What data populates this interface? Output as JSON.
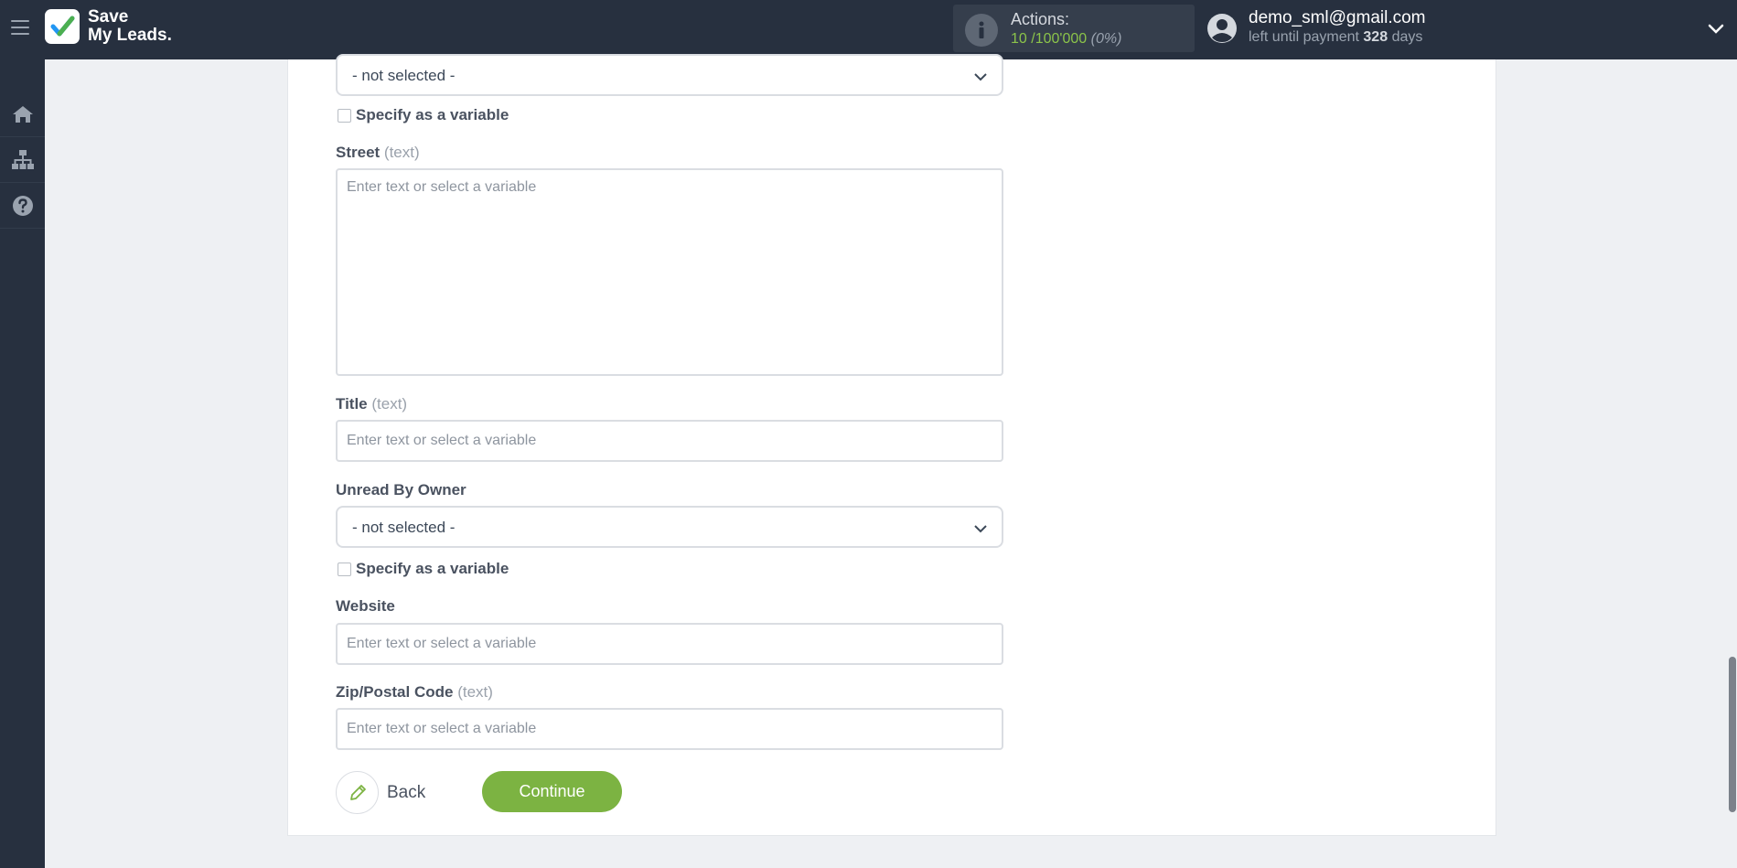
{
  "app": {
    "brand_line1": "Save",
    "brand_line2": "My Leads."
  },
  "header": {
    "actions_label": "Actions:",
    "actions_used": "10",
    "actions_total": "100'000",
    "actions_percent": "(0%)",
    "user_email": "demo_sml@gmail.com",
    "payment_prefix": "left until payment",
    "payment_days": "328",
    "payment_suffix": "days"
  },
  "sidebar": {
    "items": [
      {
        "icon": "home-icon"
      },
      {
        "icon": "sitemap-icon"
      },
      {
        "icon": "help-icon"
      }
    ]
  },
  "form": {
    "top_select": {
      "value": "- not selected -",
      "variable_label": "Specify as a variable"
    },
    "street": {
      "label": "Street",
      "hint": "(text)",
      "placeholder": "Enter text or select a variable"
    },
    "title": {
      "label": "Title",
      "hint": "(text)",
      "placeholder": "Enter text or select a variable"
    },
    "unread_by_owner": {
      "label": "Unread By Owner",
      "value": "- not selected -",
      "variable_label": "Specify as a variable"
    },
    "website": {
      "label": "Website",
      "placeholder": "Enter text or select a variable"
    },
    "zip": {
      "label": "Zip/Postal Code",
      "hint": "(text)",
      "placeholder": "Enter text or select a variable"
    },
    "back_label": "Back",
    "continue_label": "Continue"
  },
  "colors": {
    "accent_green": "#7cb342",
    "topbar": "#27303f",
    "check_blue": "#2196f3",
    "check_green": "#4caf50"
  }
}
